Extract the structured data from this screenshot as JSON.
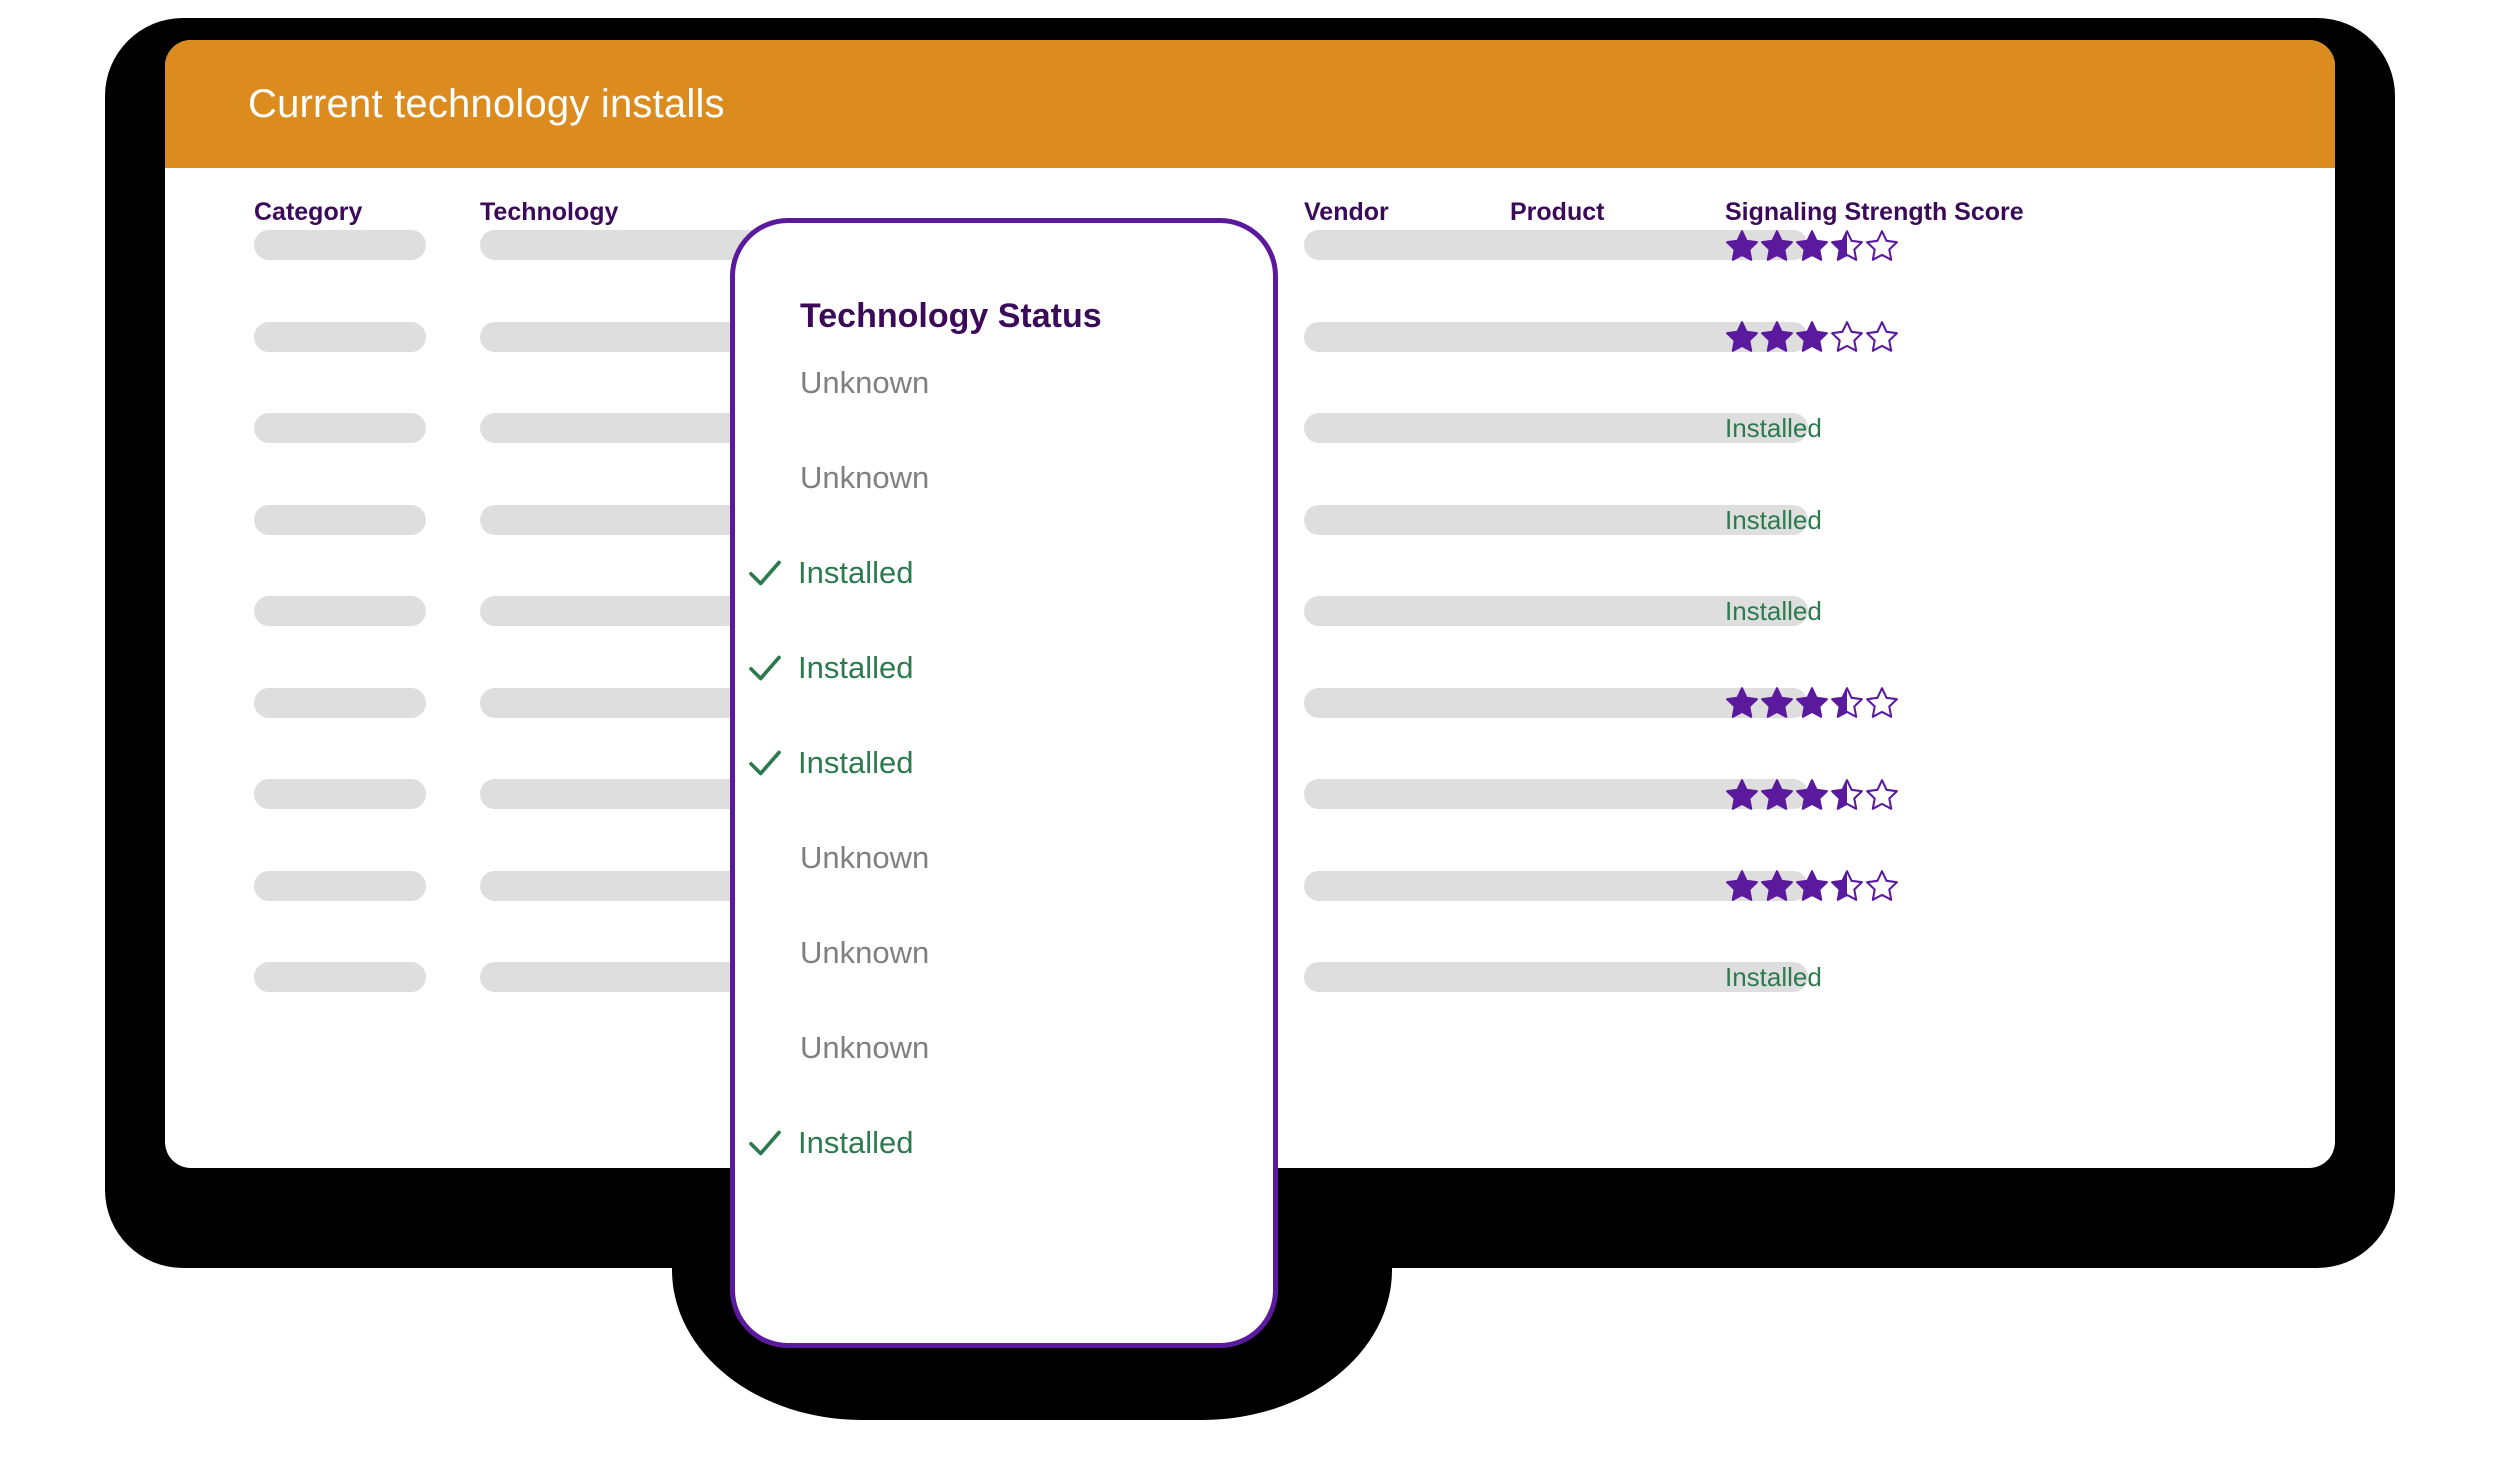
{
  "header": {
    "title": "Current technology installs",
    "background_color": "#DC8C1E",
    "text_color": "#FFFFFF"
  },
  "colors": {
    "brand_purple": "#5B1A9E",
    "header_purple": "#3B0A59",
    "orange": "#DC8C1E",
    "green": "#2D7A4F",
    "gray_text": "#808080",
    "skeleton_gray": "#DEDEDE",
    "bezel_black": "#000000"
  },
  "table": {
    "columns": [
      {
        "key": "category",
        "label": "Category"
      },
      {
        "key": "technology",
        "label": "Technology"
      },
      {
        "key": "vendor",
        "label": "Vendor"
      },
      {
        "key": "product",
        "label": "Product"
      },
      {
        "key": "signal",
        "label": "Signaling Strength Score"
      }
    ],
    "rows": [
      {
        "category": "",
        "technology": "",
        "vendor": "",
        "product": "",
        "signal_type": "stars",
        "signal_value": 3.5,
        "signal_text": ""
      },
      {
        "category": "",
        "technology": "",
        "vendor": "",
        "product": "",
        "signal_type": "stars",
        "signal_value": 3.0,
        "signal_text": ""
      },
      {
        "category": "",
        "technology": "",
        "vendor": "",
        "product": "",
        "signal_type": "text",
        "signal_value": null,
        "signal_text": "Installed"
      },
      {
        "category": "",
        "technology": "",
        "vendor": "",
        "product": "",
        "signal_type": "text",
        "signal_value": null,
        "signal_text": "Installed"
      },
      {
        "category": "",
        "technology": "",
        "vendor": "",
        "product": "",
        "signal_type": "text",
        "signal_value": null,
        "signal_text": "Installed"
      },
      {
        "category": "",
        "technology": "",
        "vendor": "",
        "product": "",
        "signal_type": "stars",
        "signal_value": 3.5,
        "signal_text": ""
      },
      {
        "category": "",
        "technology": "",
        "vendor": "",
        "product": "",
        "signal_type": "stars",
        "signal_value": 3.5,
        "signal_text": ""
      },
      {
        "category": "",
        "technology": "",
        "vendor": "",
        "product": "",
        "signal_type": "stars",
        "signal_value": 3.5,
        "signal_text": ""
      },
      {
        "category": "",
        "technology": "",
        "vendor": "",
        "product": "",
        "signal_type": "text",
        "signal_value": null,
        "signal_text": "Installed"
      }
    ],
    "max_stars": 5
  },
  "phone_overlay": {
    "title": "Technology Status",
    "border_color": "#5B1A9E",
    "items": [
      {
        "status": "Unknown",
        "state": "unknown",
        "icon": null
      },
      {
        "status": "Unknown",
        "state": "unknown",
        "icon": null
      },
      {
        "status": "Installed",
        "state": "installed",
        "icon": "check-icon"
      },
      {
        "status": "Installed",
        "state": "installed",
        "icon": "check-icon"
      },
      {
        "status": "Installed",
        "state": "installed",
        "icon": "check-icon"
      },
      {
        "status": "Unknown",
        "state": "unknown",
        "icon": null
      },
      {
        "status": "Unknown",
        "state": "unknown",
        "icon": null
      },
      {
        "status": "Unknown",
        "state": "unknown",
        "icon": null
      },
      {
        "status": "Installed",
        "state": "installed",
        "icon": "check-icon"
      }
    ]
  }
}
